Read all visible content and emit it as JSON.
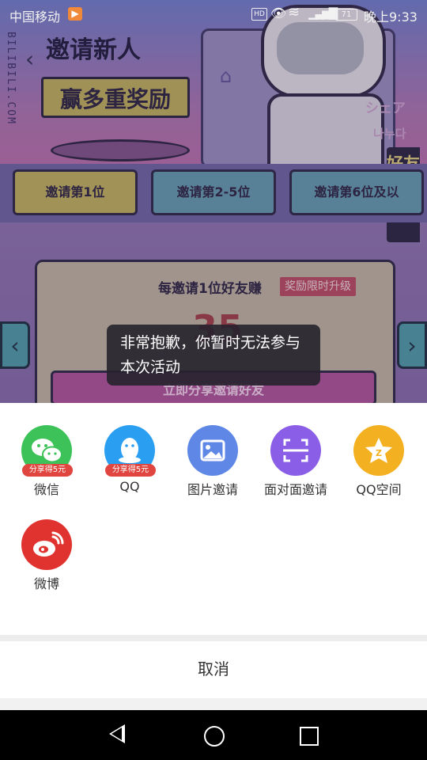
{
  "status_bar": {
    "carrier": "中国移动",
    "clock": "晚上9:33",
    "battery": "71",
    "hd": "HD",
    "network": "4G"
  },
  "background_page": {
    "side_label": "BILIBILI.COM",
    "title": "邀请新人",
    "subtitle": "赢多重奖励",
    "chip_jp": "シェア",
    "chip_kr": "나누다",
    "side_tab": "好友列表",
    "rank_tabs": [
      "邀请第1位",
      "邀请第2-5位",
      "邀请第6位及以"
    ],
    "card_line": "每邀请1位好友赚",
    "card_badge": "奖励限时升级",
    "card_number": "35",
    "card_cta": "立即分享邀请好友"
  },
  "toast": {
    "message": "非常抱歉，你暂时无法参与本次活动"
  },
  "share_sheet": {
    "items": [
      {
        "label": "微信",
        "icon": "wechat-icon",
        "color": "#3dc25a",
        "promo": "分享得5元"
      },
      {
        "label": "QQ",
        "icon": "qq-icon",
        "color": "#2a9ff2",
        "promo": "分享得5元"
      },
      {
        "label": "图片邀请",
        "icon": "image-icon",
        "color": "#5f88e6"
      },
      {
        "label": "面对面邀请",
        "icon": "scan-icon",
        "color": "#8a5ee6"
      },
      {
        "label": "QQ空间",
        "icon": "qzone-icon",
        "color": "#f3b020"
      },
      {
        "label": "微博",
        "icon": "weibo-icon",
        "color": "#e0332f"
      }
    ],
    "cancel_label": "取消"
  }
}
